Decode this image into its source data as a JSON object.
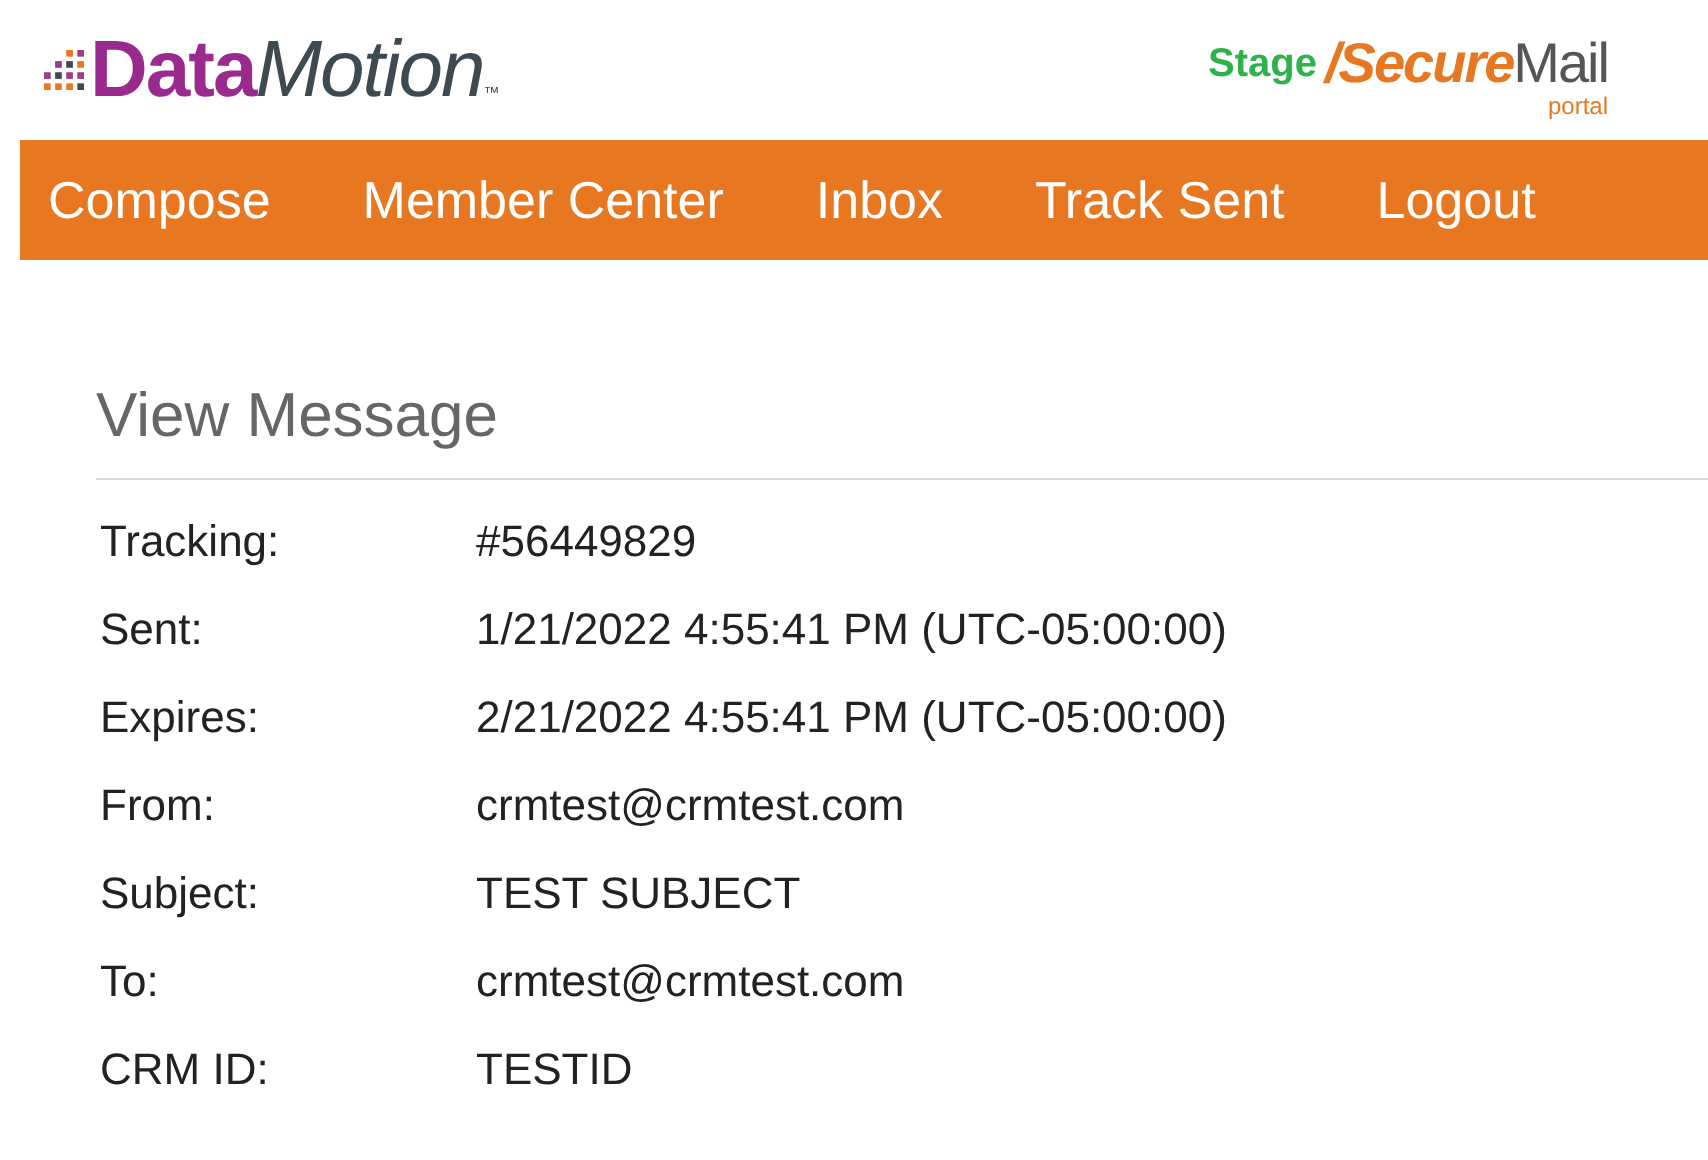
{
  "logo": {
    "data": "Data",
    "motion": "Motion",
    "tm": "™"
  },
  "portal_logo": {
    "stage": "Stage",
    "secure": "/Secure",
    "mail": "Mail",
    "portal": "portal"
  },
  "nav": [
    {
      "label": "Compose"
    },
    {
      "label": "Member Center"
    },
    {
      "label": "Inbox"
    },
    {
      "label": "Track Sent"
    },
    {
      "label": "Logout"
    }
  ],
  "page_title": "View Message",
  "fields": [
    {
      "label": "Tracking:",
      "value": "#56449829"
    },
    {
      "label": "Sent:",
      "value": "1/21/2022 4:55:41 PM (UTC-05:00:00)"
    },
    {
      "label": "Expires:",
      "value": "2/21/2022 4:55:41 PM (UTC-05:00:00)"
    },
    {
      "label": "From:",
      "value": "crmtest@crmtest.com"
    },
    {
      "label": "Subject:",
      "value": "TEST SUBJECT"
    },
    {
      "label": "To:",
      "value": "crmtest@crmtest.com"
    },
    {
      "label": "CRM ID:",
      "value": "TESTID"
    }
  ]
}
